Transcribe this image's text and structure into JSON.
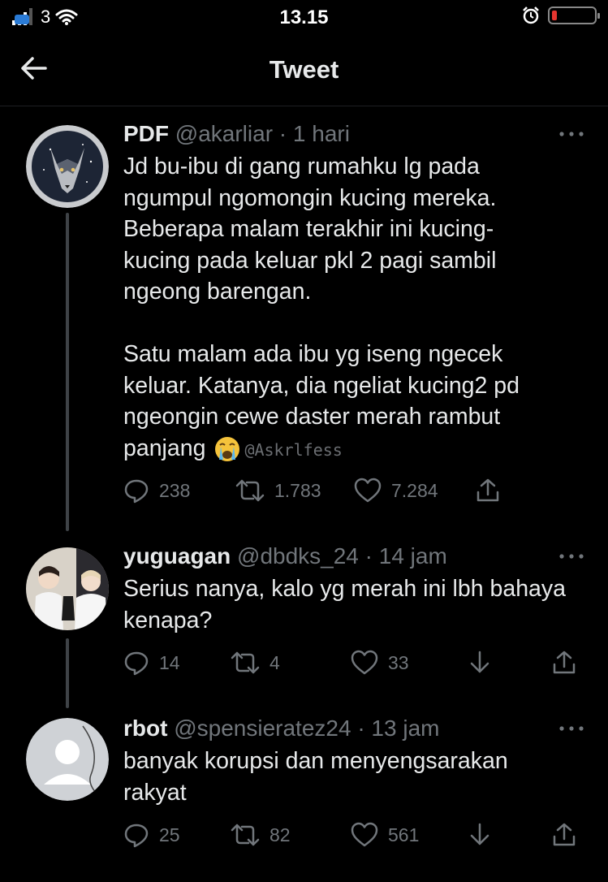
{
  "status_bar": {
    "carrier": "3",
    "time": "13.15"
  },
  "header": {
    "title": "Tweet"
  },
  "tweets": [
    {
      "name": "PDF",
      "handle": "@akarliar",
      "time": "· 1 hari",
      "text": "Jd bu-ibu di gang rumahku lg pada\nngumpul ngomongin kucing mereka.\nBeberapa malam terakhir ini kucing-\nkucing pada keluar pkl 2 pagi sambil\nngeong barengan.\n\nSatu malam ada ibu yg iseng ngecek\nkeluar. Katanya, dia ngeliat kucing2 pd\nngeongin cewe daster merah rambut\npanjang",
      "watermark": "@Askrlfess",
      "replies": "238",
      "retweets": "1.783",
      "likes": "7.284"
    },
    {
      "name": "yuguagan",
      "handle": "@dbdks_24",
      "time": "· 14 jam",
      "text": "Serius nanya, kalo yg merah ini lbh bahaya\nkenapa?",
      "replies": "14",
      "retweets": "4",
      "likes": "33"
    },
    {
      "name": "rbot",
      "handle": "@spensieratez24",
      "time": "· 13 jam",
      "text": "banyak korupsi dan menyengsarakan\nrakyat",
      "replies": "25",
      "retweets": "82",
      "likes": "561"
    }
  ],
  "icons": {
    "back": "arrow-left-icon",
    "more": "more-dots-icon",
    "reply": "reply-icon",
    "retweet": "retweet-icon",
    "like": "heart-icon",
    "share": "share-icon",
    "downvote": "downvote-icon",
    "emoji": "loudly-crying-face-emoji"
  },
  "colors": {
    "background": "#000000",
    "text": "#e7e9ea",
    "secondary": "#71767b",
    "thread_line": "#3f4347",
    "battery_low": "#e5352f"
  },
  "battery_level": 0.1
}
